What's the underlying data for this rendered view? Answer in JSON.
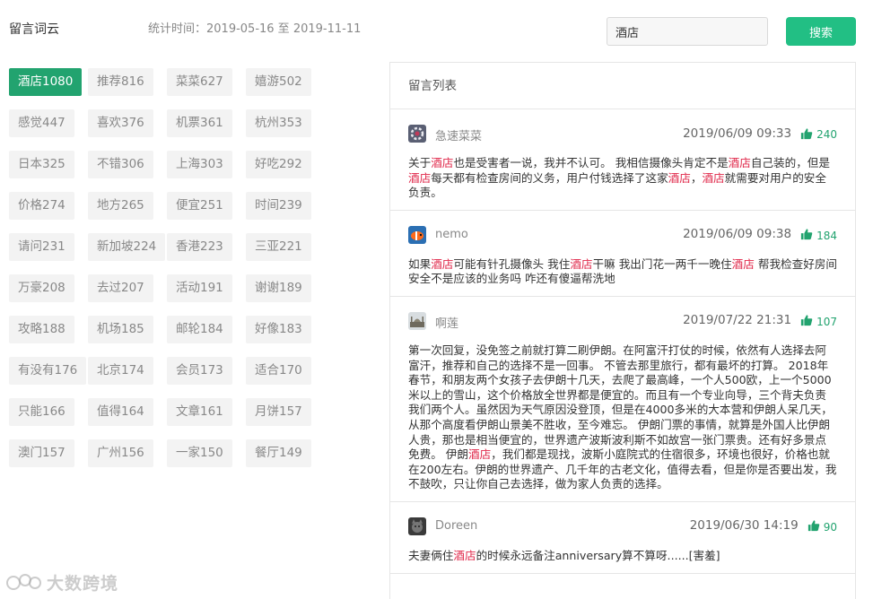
{
  "header": {
    "title": "留言词云",
    "stat_time": "统计时间：2019-05-16 至 2019-11-11"
  },
  "search": {
    "value": "酒店",
    "button_label": "搜索"
  },
  "tags": [
    {
      "label": "酒店1080",
      "active": true
    },
    {
      "label": "推荐816"
    },
    {
      "label": "菜菜627"
    },
    {
      "label": "嬉游502"
    },
    {
      "label": "感觉447"
    },
    {
      "label": "喜欢376"
    },
    {
      "label": "机票361"
    },
    {
      "label": "杭州353"
    },
    {
      "label": "日本325"
    },
    {
      "label": "不错306"
    },
    {
      "label": "上海303"
    },
    {
      "label": "好吃292"
    },
    {
      "label": "价格274"
    },
    {
      "label": "地方265"
    },
    {
      "label": "便宜251"
    },
    {
      "label": "时间239"
    },
    {
      "label": "请问231"
    },
    {
      "label": "新加坡224"
    },
    {
      "label": "香港223"
    },
    {
      "label": "三亚221"
    },
    {
      "label": "万豪208"
    },
    {
      "label": "去过207"
    },
    {
      "label": "活动191"
    },
    {
      "label": "谢谢189"
    },
    {
      "label": "攻略188"
    },
    {
      "label": "机场185"
    },
    {
      "label": "邮轮184"
    },
    {
      "label": "好像183"
    },
    {
      "label": "有没有176"
    },
    {
      "label": "北京174"
    },
    {
      "label": "会员173"
    },
    {
      "label": "适合170"
    },
    {
      "label": "只能166"
    },
    {
      "label": "值得164"
    },
    {
      "label": "文章161"
    },
    {
      "label": "月饼157"
    },
    {
      "label": "澳门157"
    },
    {
      "label": "广州156"
    },
    {
      "label": "一家150"
    },
    {
      "label": "餐厅149"
    }
  ],
  "panel": {
    "title": "留言列表"
  },
  "highlight": "酒店",
  "comments": [
    {
      "user": "急速菜菜",
      "avatar": "gear-avatar",
      "time": "2019/06/09 09:33",
      "likes": "240",
      "text": "关于酒店也是受害者一说，我并不认可。 我相信摄像头肯定不是酒店自己装的，但是酒店每天都有检查房间的义务，用户付钱选择了这家酒店，酒店就需要对用户的安全负责。"
    },
    {
      "user": "nemo",
      "avatar": "clownfish-avatar",
      "time": "2019/06/09 09:38",
      "likes": "184",
      "text": "如果酒店可能有针孔摄像头 我住酒店干嘛 我出门花一两千一晚住酒店 帮我检查好房间安全不是应该的业务吗 咋还有傻逼帮洗地"
    },
    {
      "user": "啊莲",
      "avatar": "mosque-avatar",
      "time": "2019/07/22 21:31",
      "likes": "107",
      "text": "第一次回复，没免签之前就打算二刷伊朗。在阿富汗打仗的时候，依然有人选择去阿富汗，推荐和自己的选择不是一回事。 不管去那里旅行，都有最坏的打算。 2018年春节，和朋友两个女孩子去伊朗十几天，去爬了最高峰，一个人500欧，上一个5000米以上的雪山，这个价格放全世界都是便宜的。而且有一个专业向导，三个背夫负责我们两个人。虽然因为天气原因没登顶，但是在4000多米的大本营和伊朗人呆几天，从那个高度看伊朗山景美不胜收，至今难忘。 伊朗门票的事情，就算是外国人比伊朗人贵，那也是相当便宜的，世界遗产波斯波利斯不如故宫一张门票贵。还有好多景点免费。 伊朗酒店，我们都是现找，波斯小庭院式的住宿很多，环境也很好，价格也就在200左右。伊朗的世界遗产、几千年的古老文化，值得去看，但是你是否要出发，我不鼓吹，只让你自己去选择，做为家人负责的选择。"
    },
    {
      "user": "Doreen",
      "avatar": "cat-avatar",
      "time": "2019/06/30 14:19",
      "likes": "90",
      "text": "夫妻俩住酒店的时候永远备注anniversary算不算呀......[害羞]"
    }
  ],
  "watermark": {
    "text": "大数跨境"
  },
  "colors": {
    "accent": "#22bf84",
    "tag_active": "#22a36f",
    "highlight": "#e0294b"
  }
}
